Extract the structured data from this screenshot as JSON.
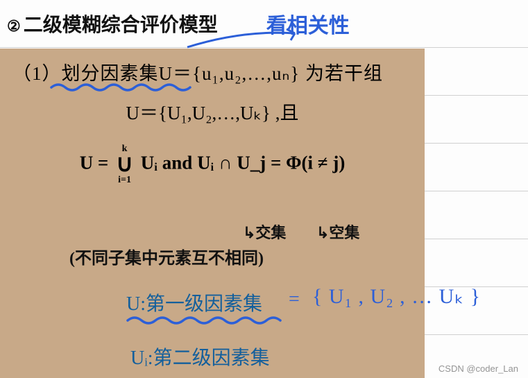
{
  "header": {
    "circled": "②",
    "title_hw": "二级模糊综合评价模型",
    "blue_note": "看相关性"
  },
  "box": {
    "line1_prefix": "（1）划分因素集U＝",
    "line1_set": "{u₁,u₂,…,uₙ}",
    "line1_suffix": " 为若干组",
    "line2": "U＝{U₁,U₂,…,Uₖ} ,且",
    "eq": {
      "lhs": "U = ",
      "union_top": "k",
      "union_bot": "i=1",
      "u_i": "Uᵢ",
      "and": "  and  ",
      "rhs": "Uᵢ ∩ U_j = Φ(i ≠ j)"
    },
    "anno_inter": "↳交集",
    "anno_phi": "↳空集",
    "anno_paren": "(不同子集中元素互不相同)",
    "label1": "U:第一级因素集",
    "label2": "Uᵢ:第二级因素集",
    "blue_eq": "=",
    "blue_set": "{ U₁ , U₂ , …  Uₖ }"
  },
  "watermark": "CSDN @coder_Lan"
}
